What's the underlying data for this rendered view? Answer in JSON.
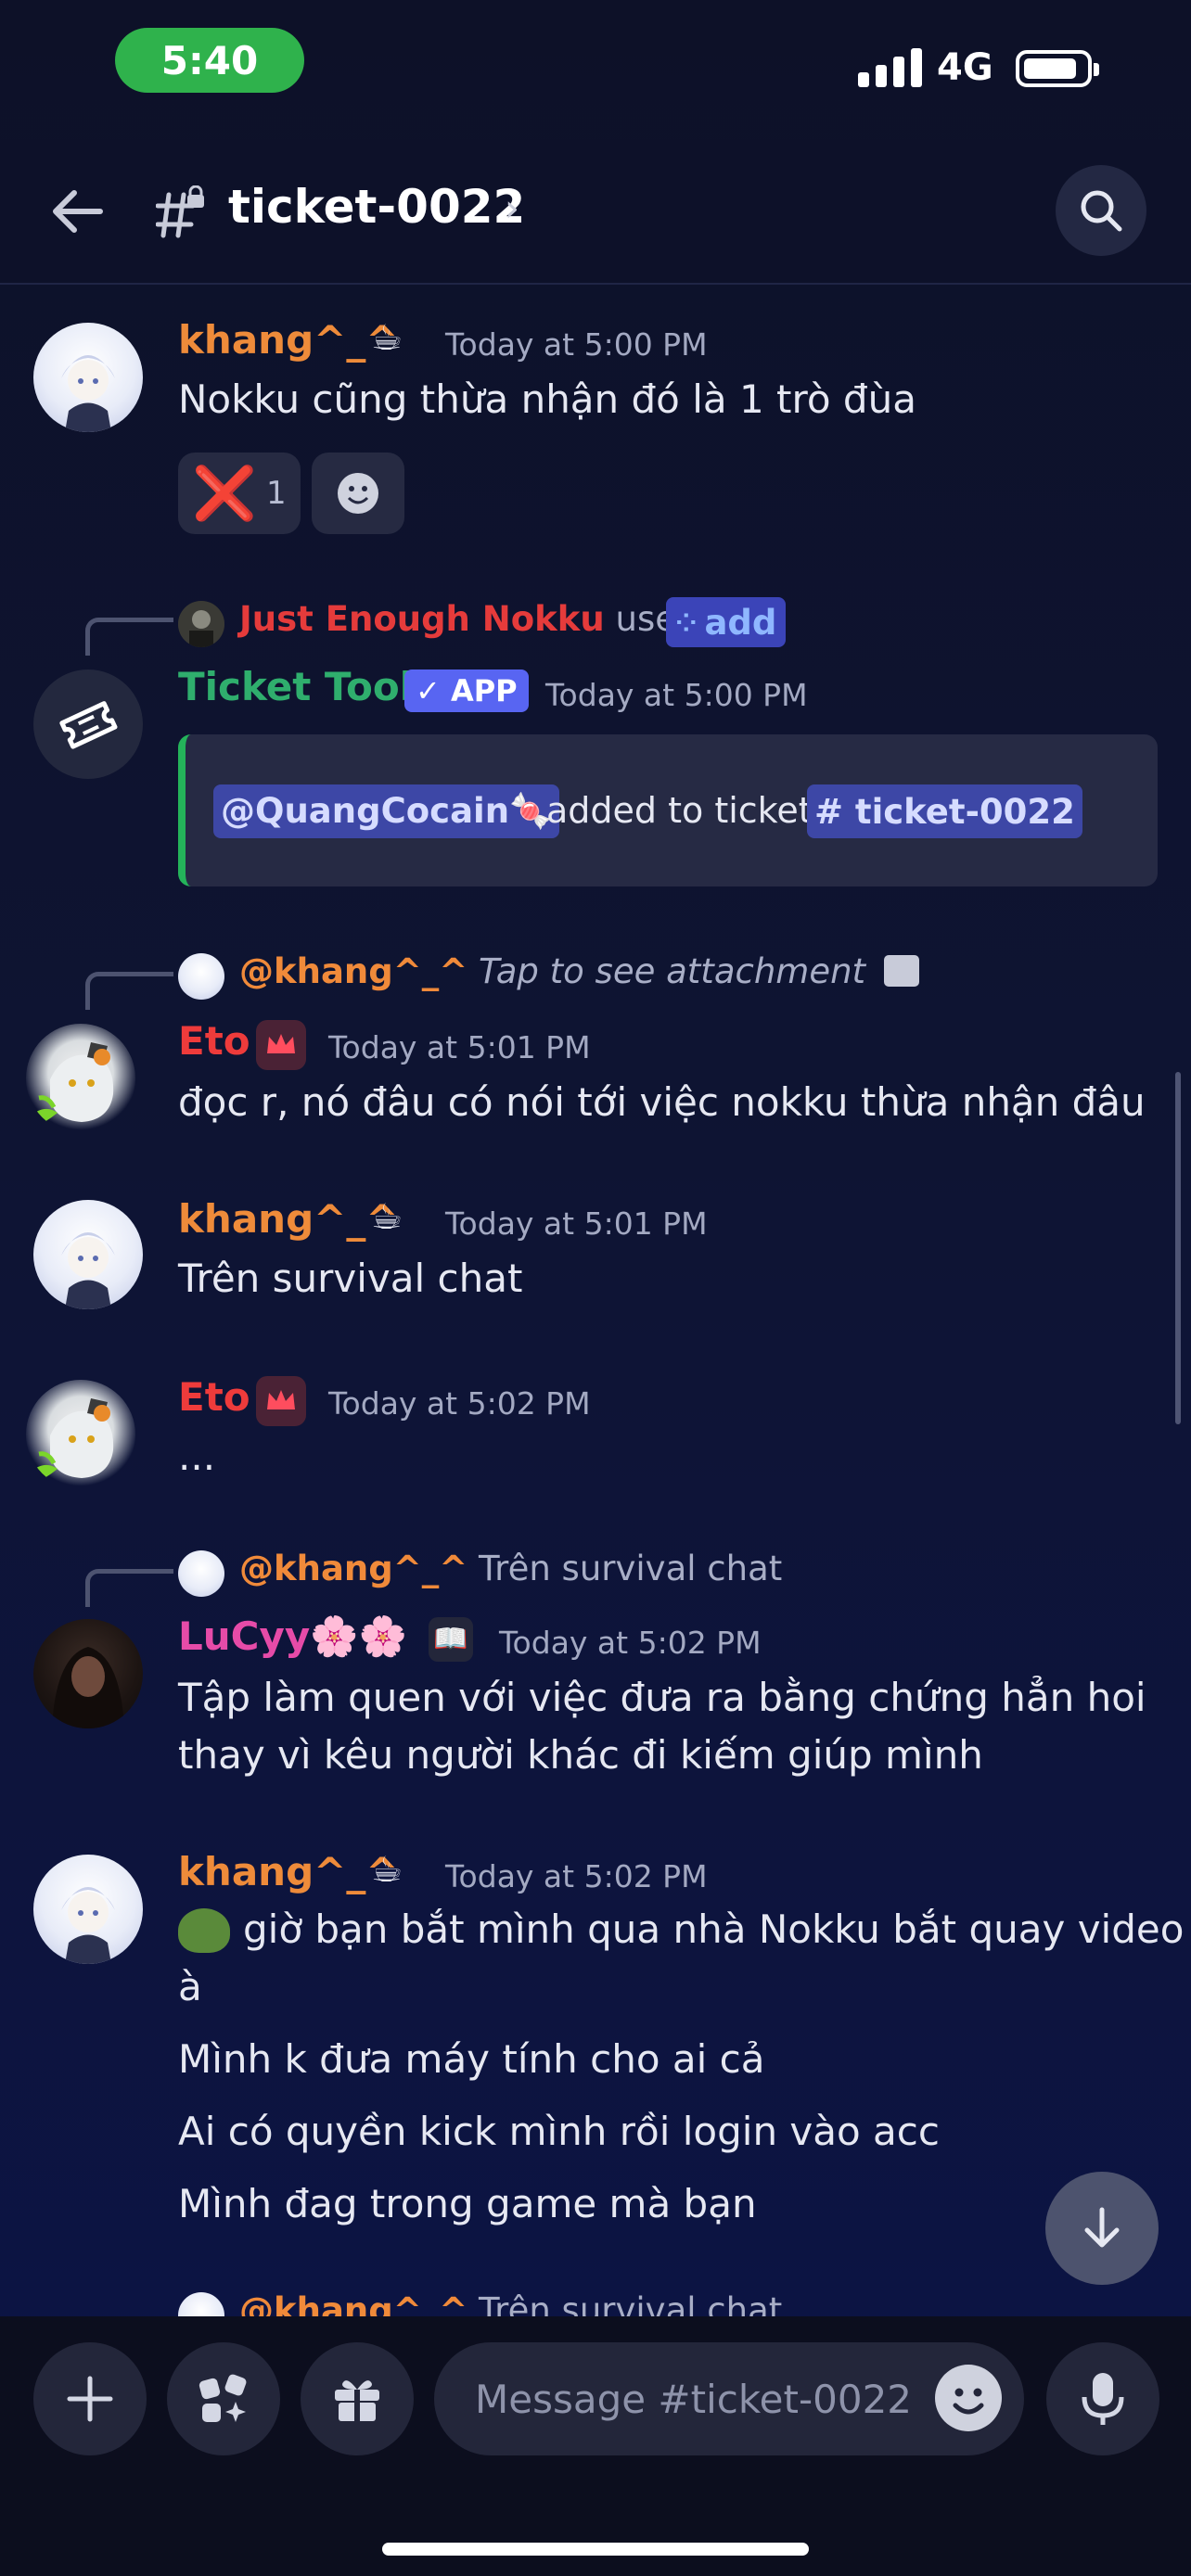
{
  "status_bar": {
    "time": "5:40",
    "network": "4G"
  },
  "header": {
    "channel_name": "ticket-0022",
    "chevron": "›"
  },
  "messages": {
    "m1": {
      "author": "khang^_^",
      "badge": "☕",
      "timestamp": "Today at 5:00 PM",
      "text": "Nokku cũng thừa nhận đó là 1 trò đùa",
      "reaction_emoji": "❌",
      "reaction_count": "1"
    },
    "m2": {
      "invoker": "Just Enough Nokku",
      "used": "used",
      "command": "add",
      "author": "Ticket Tool",
      "app_badge": "✓ APP",
      "timestamp": "Today at 5:00 PM",
      "embed_mention": "@QuangCocain🍬",
      "embed_text": "added to ticket",
      "embed_channel": "# ticket-0022"
    },
    "m3": {
      "reply_to": "@khang^_^",
      "reply_text": "Tap to see attachment",
      "author": "Eto",
      "timestamp": "Today at 5:01 PM",
      "text": "đọc r, nó đâu có nói tới việc nokku thừa nhận đâu"
    },
    "m4": {
      "author": "khang^_^",
      "badge": "☕",
      "timestamp": "Today at 5:01 PM",
      "text": "Trên survival chat"
    },
    "m5": {
      "author": "Eto",
      "timestamp": "Today at 5:02 PM",
      "text": "..."
    },
    "m6": {
      "reply_to": "@khang^_^",
      "reply_text": "Trên survival chat",
      "author": "LuCyy🌸🌸",
      "badge": "📖",
      "timestamp": "Today at 5:02 PM",
      "line1": "Tập làm quen với việc đưa ra bằng chứng hẳn hoi",
      "line2": "thay vì kêu người khác đi kiếm giúp mình"
    },
    "m7": {
      "author": "khang^_^",
      "badge": "☕",
      "timestamp": "Today at 5:02 PM",
      "line1": "giờ bạn bắt mình qua nhà Nokku bắt quay video",
      "line2": "à",
      "line3": "Mình k đưa máy tính cho ai cả",
      "line4": "Ai có quyền kick mình rồi login vào acc",
      "line5": "Mình đag trong game mà bạn"
    },
    "m8": {
      "reply_to": "@khang^_^",
      "reply_text": "Trên survival chat"
    }
  },
  "composer": {
    "placeholder": "Message #ticket-0022"
  },
  "colors": {
    "khang": "#ee8b3a",
    "eto": "#ee3b3b",
    "ticket_tool": "#2fae6d",
    "lucy": "#e64ba8",
    "invoker": "#e53b3b",
    "accent": "#5865f2"
  }
}
